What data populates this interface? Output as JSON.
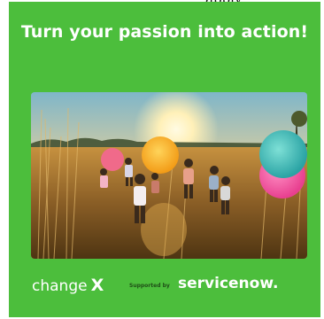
{
  "page": {
    "top_fragment": "apply",
    "background": "#ffffff"
  },
  "card": {
    "background": "#4cbe3c",
    "headline": "Turn your passion into action!",
    "photo": {
      "alt_icon": "photo-children-running-field"
    },
    "footer": {
      "changex_logo": {
        "word": "change",
        "mark": "X"
      },
      "supported_by": "Supported by",
      "servicenow_logo": {
        "word": "servicenow",
        "dot": "."
      }
    }
  }
}
